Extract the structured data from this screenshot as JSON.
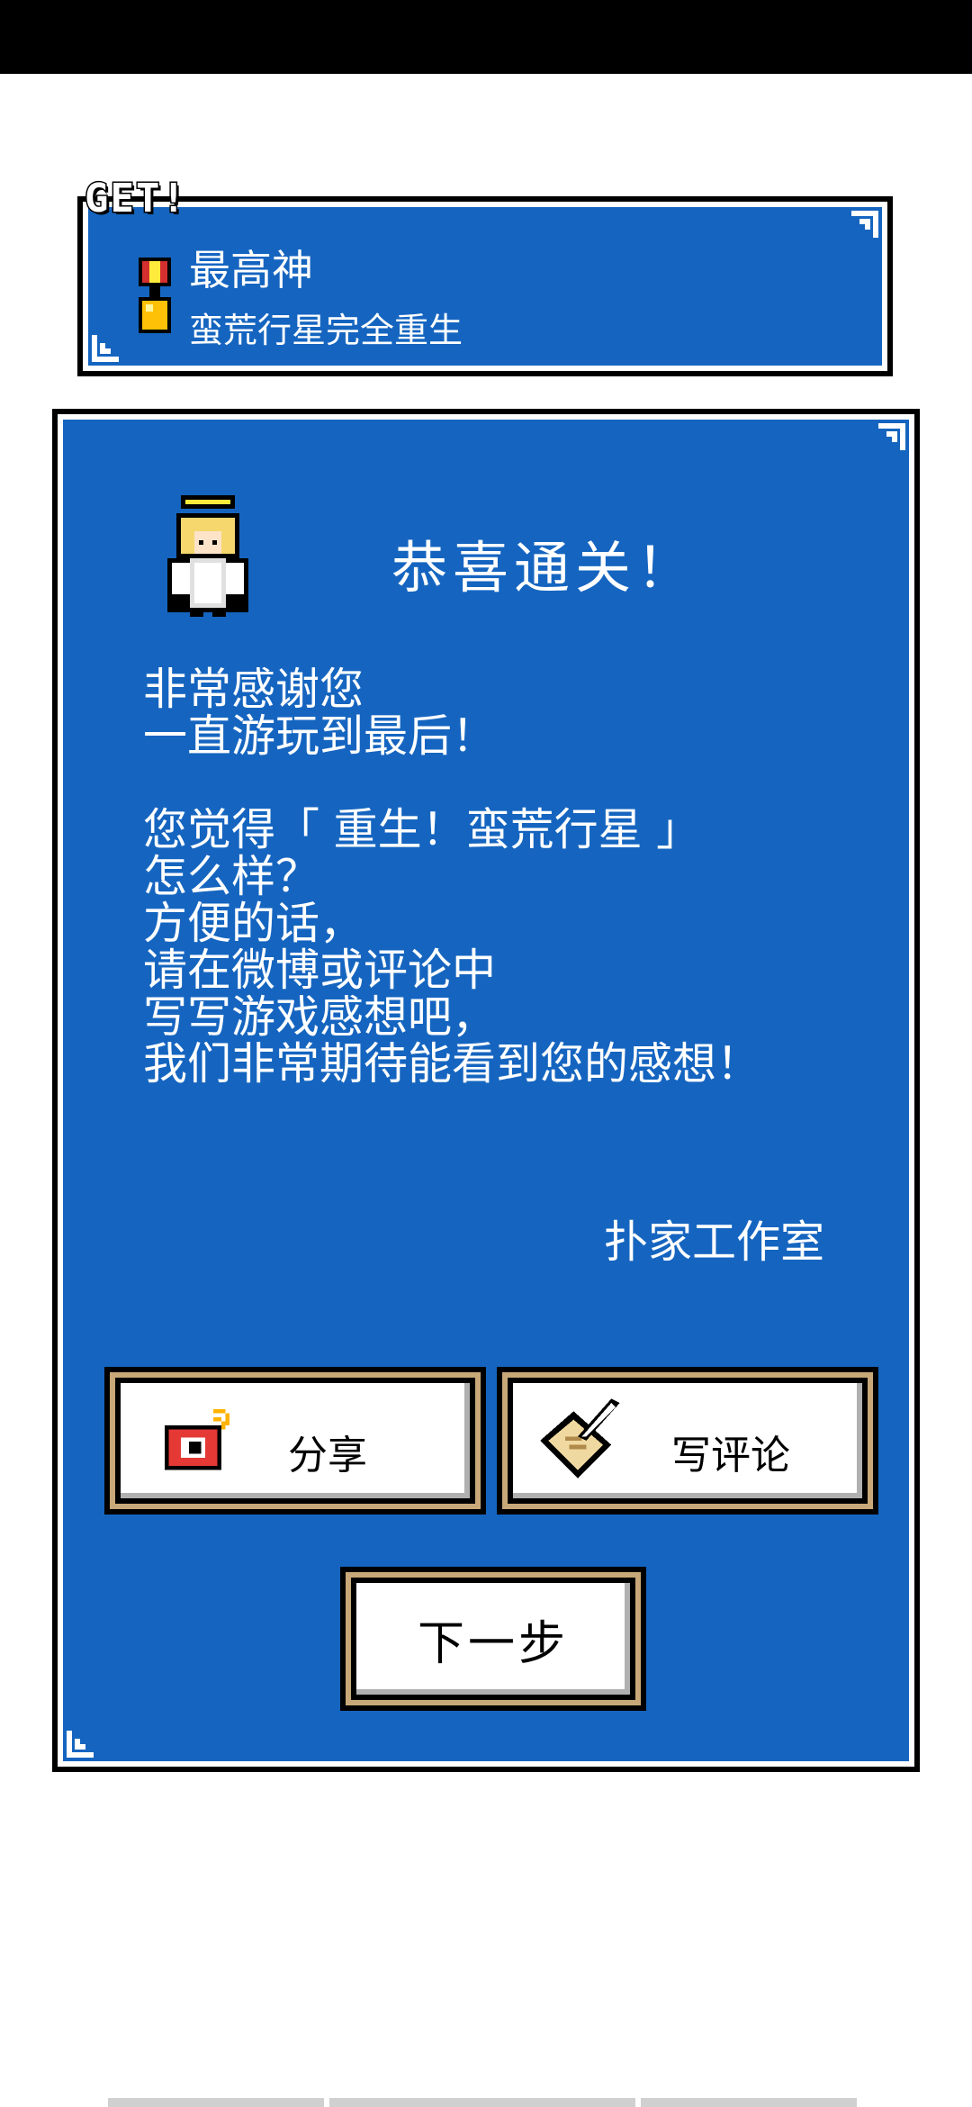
{
  "badge": {
    "label": "GET!"
  },
  "achievement": {
    "title": "最高神",
    "description": "蛮荒行星完全重生"
  },
  "dialog": {
    "title": "恭喜通关！",
    "paragraph1": "非常感谢您\n一直游玩到最后！",
    "paragraph2": "您觉得「 重生！蛮荒行星 」\n怎么样？\n方便的话，\n请在微博或评论中\n写写游戏感想吧，\n我们非常期待能看到您的感想！",
    "signature": "扑家工作室"
  },
  "buttons": {
    "share_label": "分享",
    "review_label": "写评论",
    "next_label": "下一步"
  },
  "icons": {
    "medal": "medal-icon",
    "angel": "angel-icon",
    "weibo": "weibo-icon",
    "quill": "quill-paper-icon"
  },
  "colors": {
    "panel_blue": "#1565c0",
    "button_frame": "#c8a878"
  }
}
